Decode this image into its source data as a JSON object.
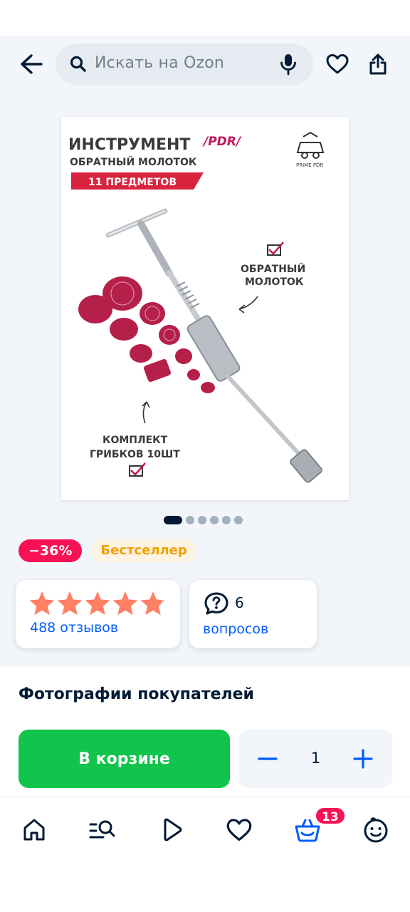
{
  "header": {
    "search_placeholder": "Искать на Ozon"
  },
  "product": {
    "image_text": {
      "title": "ИНСТРУМЕНТ",
      "title_tag": "/PDR/",
      "subtitle": "ОБРАТНЫЙ МОЛОТОК",
      "ribbon": "11   ПРЕДМЕТОВ",
      "brand": "PRIME PDR",
      "label_right_1": "ОБРАТНЫЙ",
      "label_right_2": "МОЛОТОК",
      "label_left_1": "КОМПЛЕКТ",
      "label_left_2": "ГРИБКОВ 10ШТ"
    },
    "gallery": {
      "total_images": 6,
      "current_index": 0
    },
    "badges": {
      "discount": "−36%",
      "bestseller": "Бестселлер"
    },
    "rating": {
      "stars": 5,
      "reviews_label": "488 отзывов"
    },
    "questions": {
      "count": "6",
      "label": "вопросов"
    }
  },
  "buyer_photos": {
    "title": "Фотографии покупателей"
  },
  "cart": {
    "button_label": "В корзине",
    "quantity": "1"
  },
  "bottom_nav": {
    "items": [
      "home-icon",
      "catalog-search-icon",
      "video-play-icon",
      "favorites-heart-icon",
      "cart-basket-icon",
      "profile-smile-icon"
    ],
    "cart_count": "13"
  },
  "colors": {
    "accent_blue": "#005bff",
    "buy_green": "#10c44c",
    "discount_red": "#f91155",
    "bestseller_orange": "#f1a100",
    "star_color": "#ff8064",
    "text_dark": "#001a34",
    "product_accent": "#b5204a"
  }
}
